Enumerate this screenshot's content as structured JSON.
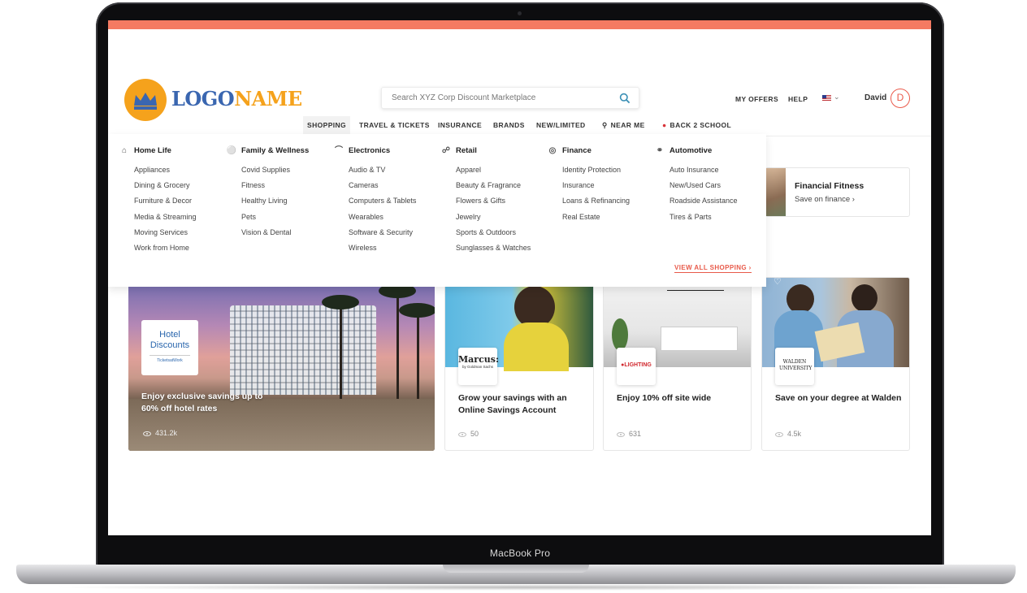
{
  "device": {
    "label": "MacBook Pro"
  },
  "header": {
    "logo": {
      "part1": "LOGO",
      "part2": "NAME"
    },
    "search": {
      "placeholder": "Search XYZ Corp Discount Marketplace"
    },
    "links": {
      "my_offers": "MY OFFERS",
      "help": "HELP"
    },
    "user": {
      "name": "David",
      "initial": "D"
    }
  },
  "nav": {
    "items": [
      {
        "label": "SHOPPING"
      },
      {
        "label": "TRAVEL & TICKETS"
      },
      {
        "label": "INSURANCE"
      },
      {
        "label": "BRANDS"
      },
      {
        "label": "NEW/LIMITED"
      },
      {
        "label": "NEAR ME"
      },
      {
        "label": "BACK 2 SCHOOL"
      }
    ]
  },
  "mega_menu": {
    "columns": [
      {
        "heading": "Home Life",
        "icon": "house-icon",
        "items": [
          "Appliances",
          "Dining & Grocery",
          "Furniture & Decor",
          "Media & Streaming",
          "Moving Services",
          "Work from Home"
        ]
      },
      {
        "heading": "Family & Wellness",
        "icon": "family-icon",
        "items": [
          "Covid Supplies",
          "Fitness",
          "Healthy Living",
          "Pets",
          "Vision & Dental"
        ]
      },
      {
        "heading": "Electronics",
        "icon": "plug-icon",
        "items": [
          "Audio & TV",
          "Cameras",
          "Computers & Tablets",
          "Wearables",
          "Software & Security",
          "Wireless"
        ]
      },
      {
        "heading": "Retail",
        "icon": "cart-icon",
        "items": [
          "Apparel",
          "Beauty & Fragrance",
          "Flowers & Gifts",
          "Jewelry",
          "Sports & Outdoors",
          "Sunglasses & Watches"
        ]
      },
      {
        "heading": "Finance",
        "icon": "coins-icon",
        "items": [
          "Identity Protection",
          "Insurance",
          "Loans & Refinancing",
          "Real Estate"
        ]
      },
      {
        "heading": "Automotive",
        "icon": "car-icon",
        "items": [
          "Auto Insurance",
          "New/Used Cars",
          "Roadside Assistance",
          "Tires & Parts"
        ]
      }
    ],
    "view_all": "VIEW ALL SHOPPING"
  },
  "promo": {
    "title": "Financial Fitness",
    "subtitle": "Save on finance"
  },
  "offers": [
    {
      "brand": "Hotel Discounts",
      "brand_sub": "TicketsatWork",
      "title": "Enjoy exclusive savings up to 60% off hotel rates",
      "views": "431.2k"
    },
    {
      "brand": "Marcus:",
      "brand_sub": "by Goldman Sachs",
      "title": "Grow your savings with an Online Savings Account",
      "views": "50"
    },
    {
      "brand": "LIGHTING",
      "brand_sub": "",
      "title": "Enjoy 10% off site wide",
      "views": "631"
    },
    {
      "brand": "WALDEN UNIVERSITY",
      "brand_sub": "",
      "title": "Save on your degree at Walden",
      "views": "4.5k"
    }
  ],
  "colors": {
    "accent_bar": "#f47a62",
    "logo_orange": "#f5a21c",
    "logo_blue": "#3a66b0",
    "link_red": "#e85a4a"
  }
}
